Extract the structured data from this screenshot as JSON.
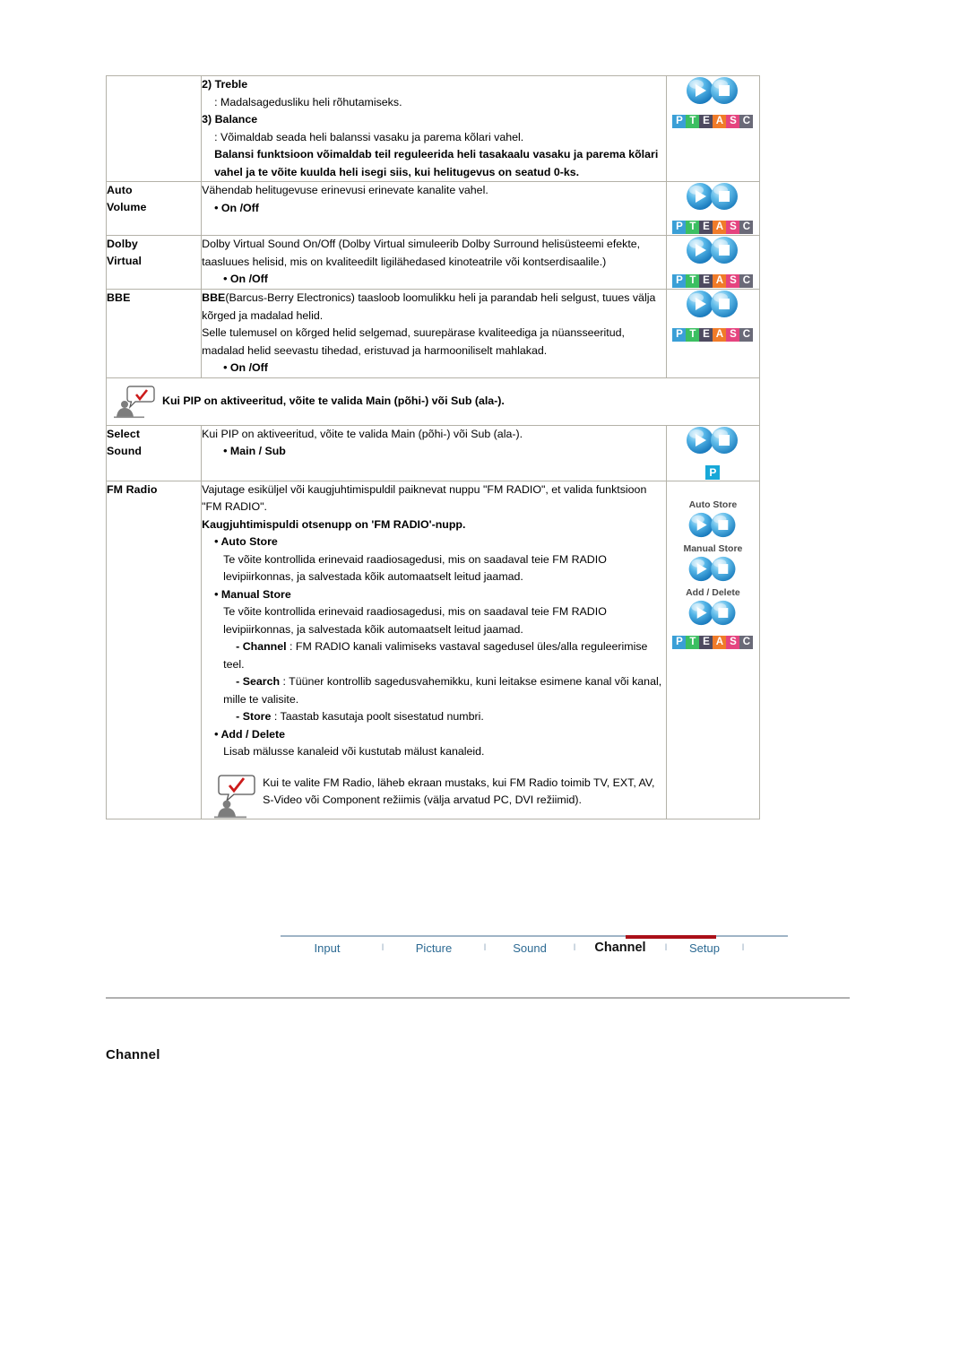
{
  "document": {
    "section_title": "Channel"
  },
  "table": {
    "rows": [
      {
        "label": "",
        "body": {
          "items": [
            {
              "text": "2) Treble",
              "style": "bold"
            },
            {
              "text": ": Madalsagedusliku heli rõhutamiseks.",
              "style": "indent1"
            },
            {
              "text": "3) Balance",
              "style": "bold"
            },
            {
              "text": ": Võimaldab seada heli balanssi vasaku ja parema kõlari vahel.",
              "style": "indent1"
            },
            {
              "text": "Balansi funktsioon võimaldab teil reguleerida heli tasakaalu vasaku ja parema kõlari vahel ja te võite kuulda heli isegi siis, kui helitugevus on seatud 0-ks.",
              "style": "indent1-bold"
            }
          ]
        },
        "icon": "twin-button-pteasc"
      },
      {
        "label": "Auto\nVolume",
        "label_lines": [
          "Auto",
          "Volume"
        ],
        "body": {
          "items": [
            {
              "text": "Vähendab helitugevuse erinevusi erinevate kanalite vahel.",
              "style": "normal"
            },
            {
              "text": "• On /Off",
              "style": "indent1-bold"
            }
          ]
        },
        "icon": "twin-button-pteasc"
      },
      {
        "label_lines": [
          "Dolby",
          "Virtual"
        ],
        "body": {
          "items": [
            {
              "text": "Dolby Virtual Sound On/Off (Dolby Virtual simuleerib Dolby Surround helisüsteemi efekte, taasluues helisid, mis on kvaliteedilt ligilähedased kinoteatrile või kontserdisaalile.)",
              "style": "normal"
            },
            {
              "text": "• On /Off",
              "style": "indent2-bold"
            }
          ]
        },
        "icon": "twin-button-pteasc"
      },
      {
        "label_lines": [
          "BBE"
        ],
        "body": {
          "items": [
            {
              "text": "BBE",
              "style": "bold-inline",
              "rest": "(Barcus-Berry Electronics) taasloob loomulikku heli ja parandab heli selgust, tuues välja kõrged ja madalad helid."
            },
            {
              "text": "Selle tulemusel on kõrged helid selgemad, suurepärase kvaliteediga ja nüansseeritud, madalad helid seevastu tihedad, eristuvad ja harmooniliselt mahlakad.",
              "style": "normal"
            },
            {
              "text": "• On /Off",
              "style": "indent2-bold"
            }
          ]
        },
        "icon": "twin-button-pteasc"
      },
      {
        "type": "note",
        "note_text": "Kui PIP on aktiveeritud, võite te valida Main (põhi-) või Sub (ala-)."
      },
      {
        "label_lines": [
          "Select",
          "Sound"
        ],
        "body": {
          "items": [
            {
              "text": "Kui PIP on aktiveeritud, võite te valida Main (põhi-) või Sub (ala-).",
              "style": "normal"
            },
            {
              "text": "• Main / Sub",
              "style": "indent2-bold"
            }
          ]
        },
        "icon": "twin-button-p"
      },
      {
        "label_lines": [
          "FM Radio"
        ],
        "body": {
          "items": [
            {
              "text": "Vajutage esiküljel või kaugjuhtimispuldil paiknevat nuppu \"FM RADIO\", et valida funktsioon \"FM RADIO\".",
              "style": "normal"
            },
            {
              "text": "Kaugjuhtimispuldi otsenupp on 'FM RADIO'-nupp.",
              "style": "bold"
            },
            {
              "text": "• Auto Store",
              "style": "indent1-bold"
            },
            {
              "text": "Te võite kontrollida erinevaid raadiosagedusi, mis on saadaval teie FM RADIO levipiirkonnas, ja salvestada kõik automaatselt leitud jaamad.",
              "style": "indent2"
            },
            {
              "text": "• Manual Store",
              "style": "indent1-bold"
            },
            {
              "text": "Te võite kontrollida erinevaid raadiosagedusi, mis on saadaval teie FM RADIO levipiirkonnas, ja salvestada kõik automaatselt leitud jaamad.",
              "style": "indent2"
            },
            {
              "text": "- Channel",
              "style": "indent3-bold-inline",
              "rest": " : FM RADIO kanali valimiseks vastaval sagedusel üles/alla reguleerimise teel."
            },
            {
              "text": "- Search",
              "style": "indent3-bold-inline",
              "rest": " : Tüüner kontrollib sagedusvahemikku, kuni leitakse esimene kanal või kanal, mille te valisite."
            },
            {
              "text": "- Store",
              "style": "indent3-bold-inline",
              "rest": " : Taastab kasutaja poolt sisestatud numbri."
            },
            {
              "text": "• Add / Delete",
              "style": "indent1-bold"
            },
            {
              "text": "Lisab mälusse kanaleid või kustutab mälust kanaleid.",
              "style": "indent2"
            }
          ],
          "inner_note": "Kui te valite FM Radio, läheb ekraan mustaks, kui FM Radio toimib TV, EXT, AV, S-Video või Component režiimis (välja arvatud PC, DVI režiimid)."
        },
        "icon": "fm-icon-stack",
        "icon_captions": [
          "Auto Store",
          "Manual Store",
          "Add / Delete"
        ]
      }
    ]
  },
  "pteasc_badge": {
    "letters": [
      "P",
      "T",
      "E",
      "A",
      "S",
      "C"
    ],
    "colors": [
      "#3a9fd6",
      "#3cbf62",
      "#4e4a60",
      "#f07b29",
      "#e5447f",
      "#6a6a78"
    ]
  },
  "p_badge": {
    "letter": "P",
    "color": "#17a8d8"
  },
  "tabnav": {
    "tabs": [
      {
        "label": "Input",
        "active": false
      },
      {
        "label": "Picture",
        "active": false
      },
      {
        "label": "Sound",
        "active": false
      },
      {
        "label": "Channel",
        "active": true
      },
      {
        "label": "Setup",
        "active": false
      }
    ],
    "separator": "I",
    "active_color": "#aa1018",
    "link_color": "#2c6a93"
  }
}
